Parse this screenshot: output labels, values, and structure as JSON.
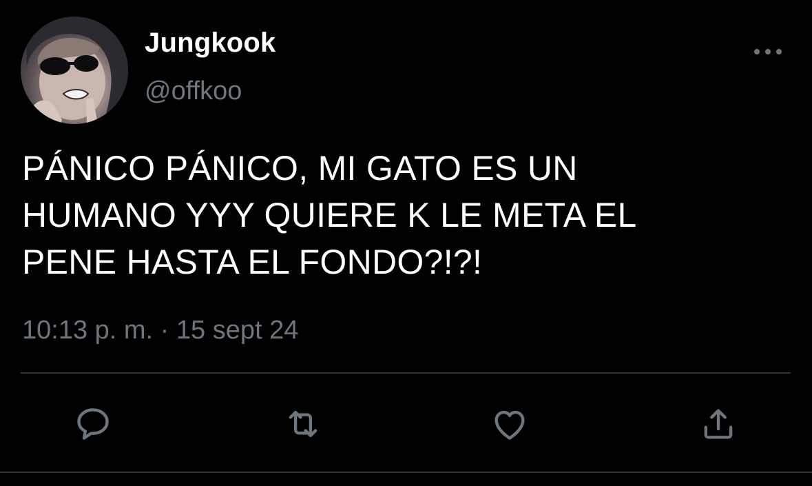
{
  "tweet": {
    "author": {
      "display_name": "Jungkook",
      "handle": "@offkoo"
    },
    "text": "PÁNICO PÁNICO, MI GATO ES UN\nHUMANO YYY QUIERE K LE META EL\nPENE HASTA EL FONDO?!?!",
    "timestamp": "10:13 p. m. · 15 sept 24"
  },
  "icons": {
    "more": "more-options-icon",
    "reply": "reply-icon",
    "retweet": "retweet-icon",
    "like": "heart-icon",
    "share": "share-icon"
  },
  "colors": {
    "background": "#000000",
    "text": "#ffffff",
    "secondary": "#6e767d",
    "divider": "#2f3336"
  }
}
